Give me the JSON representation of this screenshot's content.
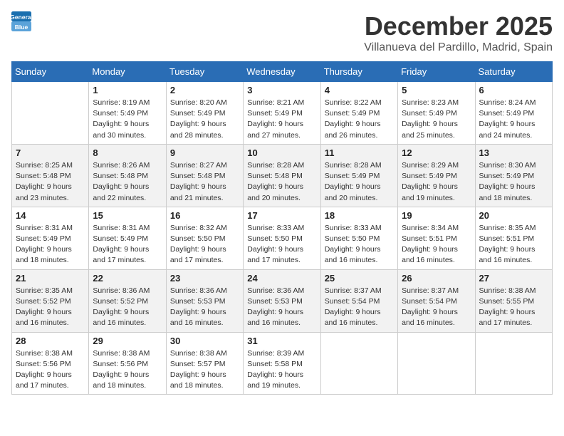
{
  "header": {
    "logo_line1": "General",
    "logo_line2": "Blue",
    "month": "December 2025",
    "location": "Villanueva del Pardillo, Madrid, Spain"
  },
  "weekdays": [
    "Sunday",
    "Monday",
    "Tuesday",
    "Wednesday",
    "Thursday",
    "Friday",
    "Saturday"
  ],
  "weeks": [
    [
      {
        "day": "",
        "info": ""
      },
      {
        "day": "1",
        "info": "Sunrise: 8:19 AM\nSunset: 5:49 PM\nDaylight: 9 hours\nand 30 minutes."
      },
      {
        "day": "2",
        "info": "Sunrise: 8:20 AM\nSunset: 5:49 PM\nDaylight: 9 hours\nand 28 minutes."
      },
      {
        "day": "3",
        "info": "Sunrise: 8:21 AM\nSunset: 5:49 PM\nDaylight: 9 hours\nand 27 minutes."
      },
      {
        "day": "4",
        "info": "Sunrise: 8:22 AM\nSunset: 5:49 PM\nDaylight: 9 hours\nand 26 minutes."
      },
      {
        "day": "5",
        "info": "Sunrise: 8:23 AM\nSunset: 5:49 PM\nDaylight: 9 hours\nand 25 minutes."
      },
      {
        "day": "6",
        "info": "Sunrise: 8:24 AM\nSunset: 5:49 PM\nDaylight: 9 hours\nand 24 minutes."
      }
    ],
    [
      {
        "day": "7",
        "info": "Sunrise: 8:25 AM\nSunset: 5:48 PM\nDaylight: 9 hours\nand 23 minutes."
      },
      {
        "day": "8",
        "info": "Sunrise: 8:26 AM\nSunset: 5:48 PM\nDaylight: 9 hours\nand 22 minutes."
      },
      {
        "day": "9",
        "info": "Sunrise: 8:27 AM\nSunset: 5:48 PM\nDaylight: 9 hours\nand 21 minutes."
      },
      {
        "day": "10",
        "info": "Sunrise: 8:28 AM\nSunset: 5:48 PM\nDaylight: 9 hours\nand 20 minutes."
      },
      {
        "day": "11",
        "info": "Sunrise: 8:28 AM\nSunset: 5:49 PM\nDaylight: 9 hours\nand 20 minutes."
      },
      {
        "day": "12",
        "info": "Sunrise: 8:29 AM\nSunset: 5:49 PM\nDaylight: 9 hours\nand 19 minutes."
      },
      {
        "day": "13",
        "info": "Sunrise: 8:30 AM\nSunset: 5:49 PM\nDaylight: 9 hours\nand 18 minutes."
      }
    ],
    [
      {
        "day": "14",
        "info": "Sunrise: 8:31 AM\nSunset: 5:49 PM\nDaylight: 9 hours\nand 18 minutes."
      },
      {
        "day": "15",
        "info": "Sunrise: 8:31 AM\nSunset: 5:49 PM\nDaylight: 9 hours\nand 17 minutes."
      },
      {
        "day": "16",
        "info": "Sunrise: 8:32 AM\nSunset: 5:50 PM\nDaylight: 9 hours\nand 17 minutes."
      },
      {
        "day": "17",
        "info": "Sunrise: 8:33 AM\nSunset: 5:50 PM\nDaylight: 9 hours\nand 17 minutes."
      },
      {
        "day": "18",
        "info": "Sunrise: 8:33 AM\nSunset: 5:50 PM\nDaylight: 9 hours\nand 16 minutes."
      },
      {
        "day": "19",
        "info": "Sunrise: 8:34 AM\nSunset: 5:51 PM\nDaylight: 9 hours\nand 16 minutes."
      },
      {
        "day": "20",
        "info": "Sunrise: 8:35 AM\nSunset: 5:51 PM\nDaylight: 9 hours\nand 16 minutes."
      }
    ],
    [
      {
        "day": "21",
        "info": "Sunrise: 8:35 AM\nSunset: 5:52 PM\nDaylight: 9 hours\nand 16 minutes."
      },
      {
        "day": "22",
        "info": "Sunrise: 8:36 AM\nSunset: 5:52 PM\nDaylight: 9 hours\nand 16 minutes."
      },
      {
        "day": "23",
        "info": "Sunrise: 8:36 AM\nSunset: 5:53 PM\nDaylight: 9 hours\nand 16 minutes."
      },
      {
        "day": "24",
        "info": "Sunrise: 8:36 AM\nSunset: 5:53 PM\nDaylight: 9 hours\nand 16 minutes."
      },
      {
        "day": "25",
        "info": "Sunrise: 8:37 AM\nSunset: 5:54 PM\nDaylight: 9 hours\nand 16 minutes."
      },
      {
        "day": "26",
        "info": "Sunrise: 8:37 AM\nSunset: 5:54 PM\nDaylight: 9 hours\nand 16 minutes."
      },
      {
        "day": "27",
        "info": "Sunrise: 8:38 AM\nSunset: 5:55 PM\nDaylight: 9 hours\nand 17 minutes."
      }
    ],
    [
      {
        "day": "28",
        "info": "Sunrise: 8:38 AM\nSunset: 5:56 PM\nDaylight: 9 hours\nand 17 minutes."
      },
      {
        "day": "29",
        "info": "Sunrise: 8:38 AM\nSunset: 5:56 PM\nDaylight: 9 hours\nand 18 minutes."
      },
      {
        "day": "30",
        "info": "Sunrise: 8:38 AM\nSunset: 5:57 PM\nDaylight: 9 hours\nand 18 minutes."
      },
      {
        "day": "31",
        "info": "Sunrise: 8:39 AM\nSunset: 5:58 PM\nDaylight: 9 hours\nand 19 minutes."
      },
      {
        "day": "",
        "info": ""
      },
      {
        "day": "",
        "info": ""
      },
      {
        "day": "",
        "info": ""
      }
    ]
  ]
}
